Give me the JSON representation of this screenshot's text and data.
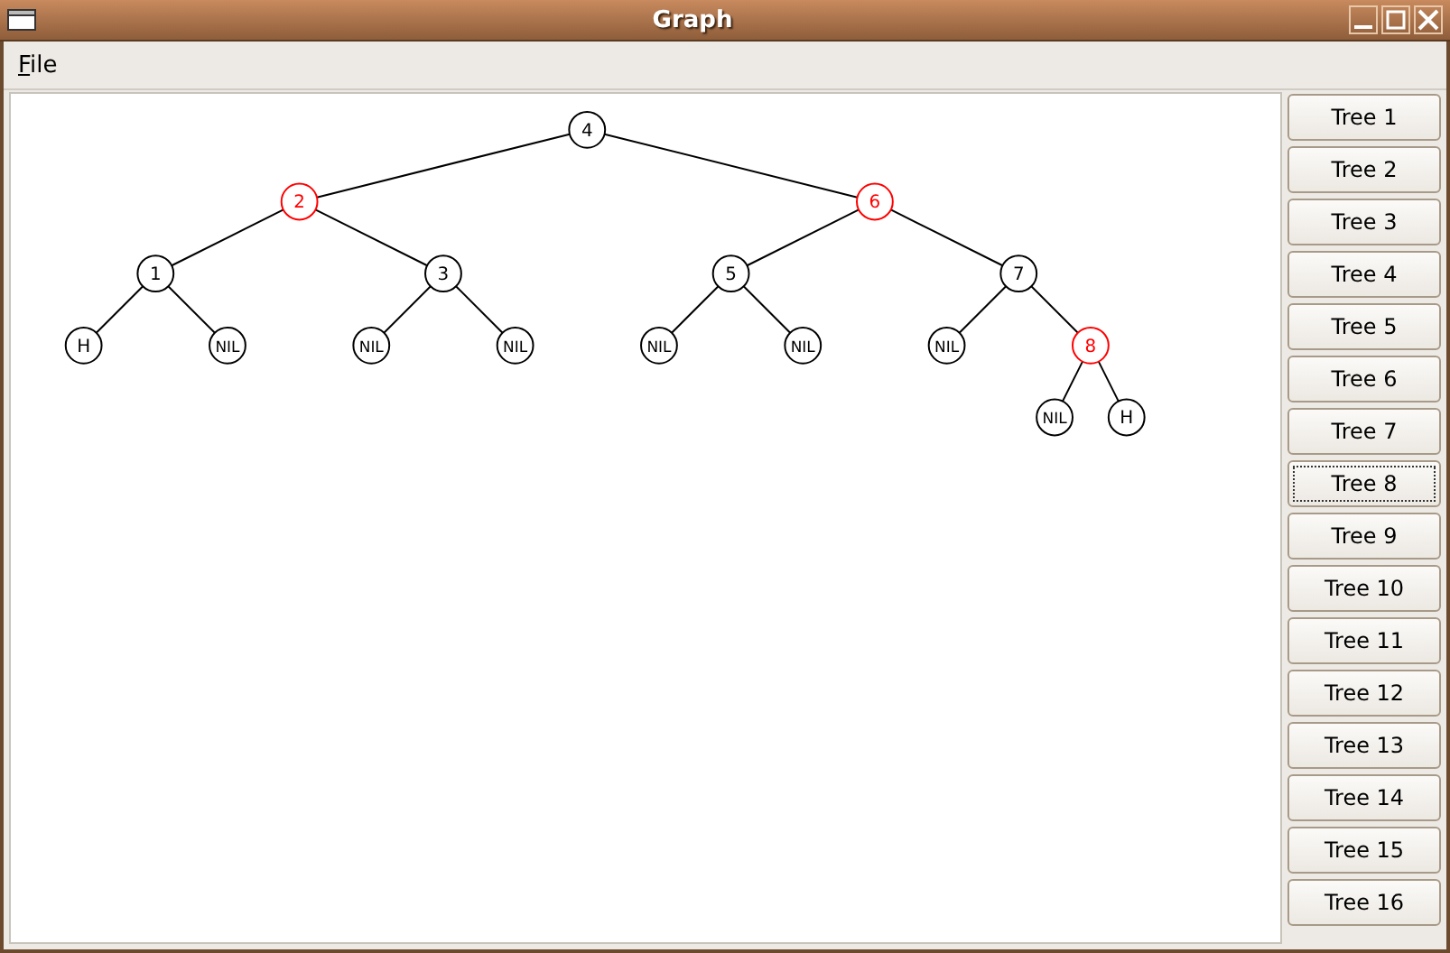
{
  "window": {
    "title": "Graph"
  },
  "menu": [
    {
      "label": "File"
    }
  ],
  "tree": {
    "label": "4",
    "color": "#000000",
    "children": [
      {
        "label": "2",
        "color": "#ff0000",
        "children": [
          {
            "label": "1",
            "color": "#000000",
            "children": [
              {
                "label": "H",
                "color": "#000000"
              },
              {
                "label": "NIL",
                "color": "#000000"
              }
            ]
          },
          {
            "label": "3",
            "color": "#000000",
            "children": [
              {
                "label": "NIL",
                "color": "#000000"
              },
              {
                "label": "NIL",
                "color": "#000000"
              }
            ]
          }
        ]
      },
      {
        "label": "6",
        "color": "#ff0000",
        "children": [
          {
            "label": "5",
            "color": "#000000",
            "children": [
              {
                "label": "NIL",
                "color": "#000000"
              },
              {
                "label": "NIL",
                "color": "#000000"
              }
            ]
          },
          {
            "label": "7",
            "color": "#000000",
            "children": [
              {
                "label": "NIL",
                "color": "#000000"
              },
              {
                "label": "8",
                "color": "#ff0000",
                "children": [
                  {
                    "label": "NIL",
                    "color": "#000000"
                  },
                  {
                    "label": "H",
                    "color": "#000000"
                  }
                ]
              }
            ]
          }
        ]
      }
    ]
  },
  "buttons": [
    {
      "label": "Tree 1",
      "focused": false
    },
    {
      "label": "Tree 2",
      "focused": false
    },
    {
      "label": "Tree 3",
      "focused": false
    },
    {
      "label": "Tree 4",
      "focused": false
    },
    {
      "label": "Tree 5",
      "focused": false
    },
    {
      "label": "Tree 6",
      "focused": false
    },
    {
      "label": "Tree 7",
      "focused": false
    },
    {
      "label": "Tree 8",
      "focused": true
    },
    {
      "label": "Tree 9",
      "focused": false
    },
    {
      "label": "Tree 10",
      "focused": false
    },
    {
      "label": "Tree 11",
      "focused": false
    },
    {
      "label": "Tree 12",
      "focused": false
    },
    {
      "label": "Tree 13",
      "focused": false
    },
    {
      "label": "Tree 14",
      "focused": false
    },
    {
      "label": "Tree 15",
      "focused": false
    },
    {
      "label": "Tree 16",
      "focused": false
    }
  ]
}
